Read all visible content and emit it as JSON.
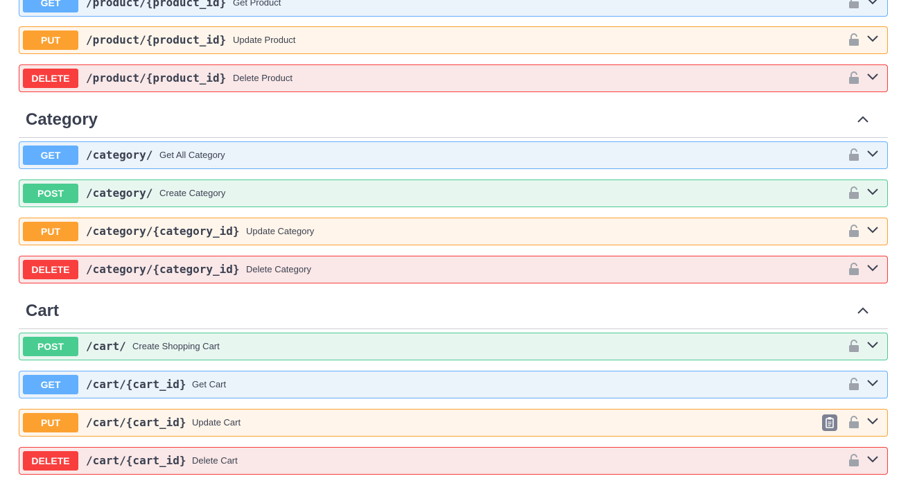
{
  "colors": {
    "get": "#61affe",
    "put": "#fca130",
    "post": "#49cc90",
    "delete": "#f93e3e",
    "text": "#3b4151"
  },
  "icons": {
    "lock": "unlocked-padlock-icon",
    "expand": "chevron-down-icon",
    "collapse": "chevron-up-icon",
    "copy": "clipboard-icon"
  },
  "product_ops": [
    {
      "method": "GET",
      "path": "/product/{product_id}",
      "summary": "Get Product"
    },
    {
      "method": "PUT",
      "path": "/product/{product_id}",
      "summary": "Update Product"
    },
    {
      "method": "DELETE",
      "path": "/product/{product_id}",
      "summary": "Delete Product"
    }
  ],
  "category": {
    "title": "Category",
    "ops": [
      {
        "method": "GET",
        "path": "/category/",
        "summary": "Get All Category"
      },
      {
        "method": "POST",
        "path": "/category/",
        "summary": "Create Category"
      },
      {
        "method": "PUT",
        "path": "/category/{category_id}",
        "summary": "Update Category"
      },
      {
        "method": "DELETE",
        "path": "/category/{category_id}",
        "summary": "Delete Category"
      }
    ]
  },
  "cart": {
    "title": "Cart",
    "ops": [
      {
        "method": "POST",
        "path": "/cart/",
        "summary": "Create Shopping Cart"
      },
      {
        "method": "GET",
        "path": "/cart/{cart_id}",
        "summary": "Get Cart"
      },
      {
        "method": "PUT",
        "path": "/cart/{cart_id}",
        "summary": "Update Cart"
      },
      {
        "method": "DELETE",
        "path": "/cart/{cart_id}",
        "summary": "Delete Cart"
      }
    ]
  }
}
